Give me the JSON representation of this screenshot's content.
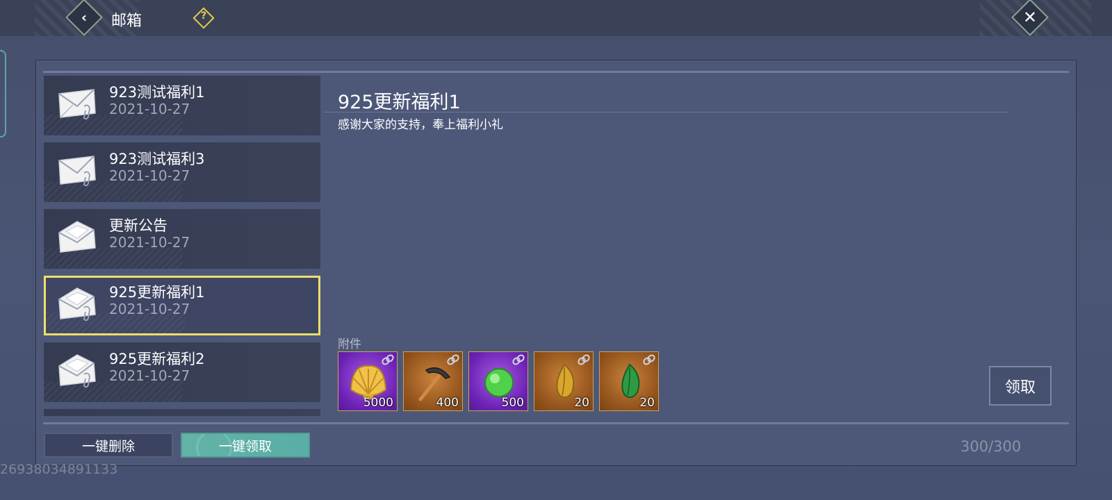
{
  "header": {
    "title": "邮箱"
  },
  "mails": [
    {
      "name": "923测试福利1",
      "date": "2021-10-27",
      "icon": "mail-attachment-icon",
      "selected": false
    },
    {
      "name": "923测试福利3",
      "date": "2021-10-27",
      "icon": "mail-attachment-icon",
      "selected": false
    },
    {
      "name": "更新公告",
      "date": "2021-10-27",
      "icon": "mail-opened-icon",
      "selected": false
    },
    {
      "name": "925更新福利1",
      "date": "2021-10-27",
      "icon": "mail-opened-attachment-icon",
      "selected": true
    },
    {
      "name": "925更新福利2",
      "date": "2021-10-27",
      "icon": "mail-opened-attachment-icon",
      "selected": false
    }
  ],
  "detail": {
    "title": "925更新福利1",
    "body": "感谢大家的支持，奉上福利小礼",
    "attachments_label": "附件",
    "attachments": [
      {
        "item": "golden-shell",
        "qty": "5000",
        "rarity": "purple"
      },
      {
        "item": "pickaxe",
        "qty": "400",
        "rarity": "orange"
      },
      {
        "item": "green-orb",
        "qty": "500",
        "rarity": "purple"
      },
      {
        "item": "gold-leaf",
        "qty": "20",
        "rarity": "orange"
      },
      {
        "item": "jade-leaf",
        "qty": "20",
        "rarity": "orange"
      }
    ],
    "claim_label": "领取"
  },
  "footer": {
    "delete_all_label": "一键删除",
    "claim_all_label": "一键领取",
    "capacity": "300/300"
  },
  "uid": "26938034891133",
  "colors": {
    "selected_border": "#eedf6a",
    "claim_all": "#5aaea5",
    "panel": "#4d5879"
  }
}
